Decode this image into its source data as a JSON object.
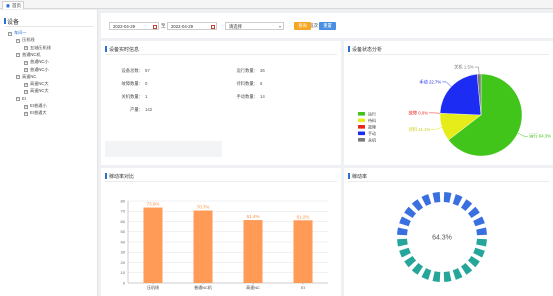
{
  "tabs": {
    "home": "首页"
  },
  "sidebar": {
    "title": "设备",
    "tree": [
      {
        "label": "车间一",
        "level": 0,
        "box": "−"
      },
      {
        "label": "压机线",
        "level": 1,
        "box": "−"
      },
      {
        "label": "五轴压机线",
        "level": 2,
        "box": "+"
      },
      {
        "label": "普通NC机",
        "level": 1,
        "box": "−"
      },
      {
        "label": "普通NC小",
        "level": 2,
        "box": "+"
      },
      {
        "label": "普通NC小",
        "level": 2,
        "box": "+"
      },
      {
        "label": "高速NC",
        "level": 1,
        "box": "−"
      },
      {
        "label": "高速NC大",
        "level": 2,
        "box": "+"
      },
      {
        "label": "高速NC大",
        "level": 2,
        "box": "+"
      },
      {
        "label": "EI",
        "level": 1,
        "box": "−"
      },
      {
        "label": "EI普通小",
        "level": 2,
        "box": "+"
      },
      {
        "label": "EI普通大",
        "level": 2,
        "box": "+"
      }
    ]
  },
  "toolbar": {
    "date_from": "2022-04-29",
    "to_label": "至",
    "date_to": "2022-04-29",
    "shift_label": "班次：",
    "shift_value": "请选择",
    "query_label": "查询",
    "reset_label": "重置"
  },
  "realtime": {
    "title": "设备实时信息",
    "stats": [
      {
        "key": "设备总数：",
        "value": "57"
      },
      {
        "key": "运行数量：",
        "value": "36"
      },
      {
        "key": "故障数量：",
        "value": "0"
      },
      {
        "key": "待料数量：",
        "value": "6"
      },
      {
        "key": "关机数量：",
        "value": "1"
      },
      {
        "key": "手动数量：",
        "value": "14"
      },
      {
        "key": "产量：",
        "value": "142"
      }
    ]
  },
  "status": {
    "title": "设备状态分析",
    "legend": [
      "运行",
      "待料",
      "故障",
      "手动",
      "关机"
    ]
  },
  "rate_bar": {
    "title": "稼动率对比"
  },
  "rate_ring": {
    "title": "稼动率",
    "value_label": "64.3%"
  },
  "colors": {
    "accent": "#2c6fd6",
    "bar": "#ff9a57",
    "run": "#41c51a",
    "wait": "#e6ec1a",
    "fault": "#e8261a",
    "manual": "#1c2cf2",
    "off": "#7a7a7a"
  },
  "chart_data": [
    {
      "type": "pie",
      "title": "设备状态分析",
      "slices": [
        {
          "name": "运行",
          "value": 64.3,
          "label": "运行 64.3%"
        },
        {
          "name": "待料",
          "value": 11.1,
          "label": "待料 11.1%"
        },
        {
          "name": "故障",
          "value": 0.0,
          "label": "故障 0.0%"
        },
        {
          "name": "手动",
          "value": 22.7,
          "label": "手动 22.7%"
        },
        {
          "name": "关机",
          "value": 1.5,
          "label": "关机 1.5%"
        }
      ],
      "legend": "left"
    },
    {
      "type": "bar",
      "title": "稼动率对比",
      "categories": [
        "压机线",
        "普通NC机",
        "高速NC",
        "EI"
      ],
      "values": [
        73.6,
        70.7,
        61.4,
        61.2
      ],
      "data_labels": [
        "73.6%",
        "70.7%",
        "61.4%",
        "61.2%"
      ],
      "yticks": [
        "0",
        "10",
        "20",
        "30",
        "40",
        "50",
        "60",
        "70",
        "80"
      ],
      "ylim": [
        0,
        80
      ],
      "grid": true
    },
    {
      "type": "gauge",
      "title": "稼动率",
      "value": 64.3,
      "label": "64.3%",
      "segments": 24
    }
  ]
}
